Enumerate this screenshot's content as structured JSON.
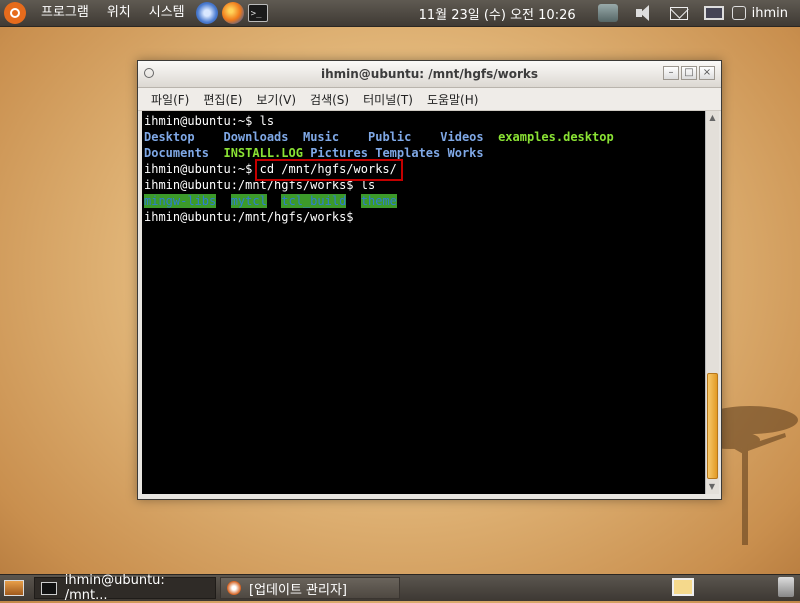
{
  "top_panel": {
    "menus": [
      "프로그램",
      "위치",
      "시스템"
    ],
    "launchers": [
      "browser-icon",
      "firefox-icon",
      "terminal-icon"
    ],
    "launcher_terminal_glyph": ">_",
    "clock": "11월 23일 (수) 오전 10:26",
    "user": "ihmin",
    "tray_icons": [
      "network-icon",
      "volume-icon",
      "mail-icon",
      "monitor-icon",
      "chat-icon"
    ]
  },
  "window": {
    "title": "ihmin@ubuntu: /mnt/hgfs/works",
    "controls": {
      "minimize": "–",
      "maximize": "□",
      "close": "×"
    },
    "menu": [
      "파일(F)",
      "편집(E)",
      "보기(V)",
      "검색(S)",
      "터미널(T)",
      "도움말(H)"
    ]
  },
  "terminal": {
    "prompt_home": "ihmin@ubuntu:~$ ",
    "prompt_works": "ihmin@ubuntu:/mnt/hgfs/works$ ",
    "cmd_ls": "ls",
    "cmd_cd": "cd /mnt/hgfs/works/",
    "home_listing": {
      "row1": [
        "Desktop",
        "Downloads",
        "Music",
        "Public",
        "Videos",
        "examples.desktop"
      ],
      "row2": [
        "Documents",
        "INSTALL.LOG",
        "Pictures",
        "Templates",
        "Works"
      ]
    },
    "works_listing": [
      "mingw-libs",
      "mytcl",
      "tcl_build",
      "theme"
    ]
  },
  "bottom_panel": {
    "tasks": [
      {
        "label": "ihmin@ubuntu: /mnt..."
      },
      {
        "label": "[업데이트 관리자]"
      }
    ]
  },
  "colors": {
    "dir": "#7fa8e6",
    "exe": "#8ae234",
    "highlight_bg": "#3c9a2a",
    "red_box": "#c40000",
    "scroll_thumb": "#e29a24"
  }
}
